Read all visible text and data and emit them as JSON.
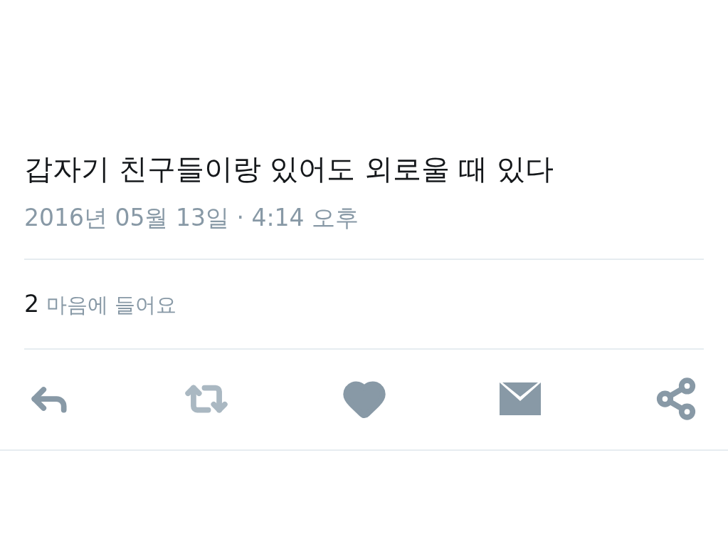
{
  "tweet": {
    "text": "갑자기 친구들이랑 있어도 외로울 때 있다",
    "timestamp": "2016년 05월 13일 · 4:14 오후"
  },
  "stats": {
    "count": "2",
    "label": "마음에 들어요"
  },
  "actions": [
    {
      "kind": "reply",
      "disabled": false
    },
    {
      "kind": "retweet",
      "disabled": true
    },
    {
      "kind": "like",
      "disabled": false
    },
    {
      "kind": "message",
      "disabled": false
    },
    {
      "kind": "share",
      "disabled": false
    }
  ]
}
